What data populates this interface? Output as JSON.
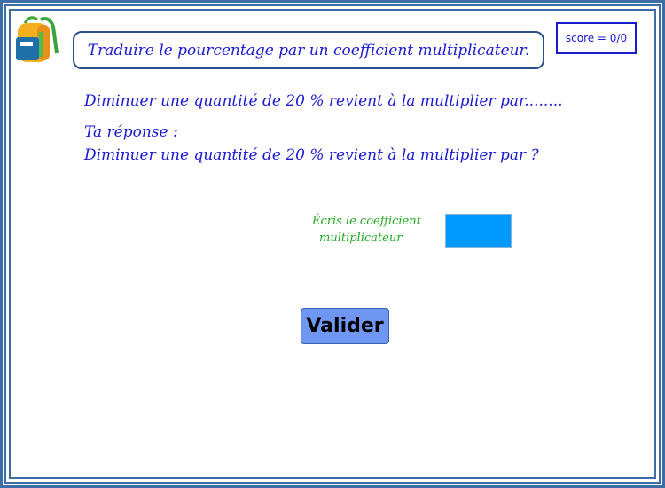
{
  "header": {
    "title": "Traduire le pourcentage par un coefficient multiplicateur.",
    "score": "score = 0/0"
  },
  "question": {
    "prompt": "Diminuer une quantité de 20 % revient à la multiplier par........",
    "answer_label": "Ta réponse :",
    "answer_restated": "Diminuer une quantité de 20 % revient à la multiplier par ?"
  },
  "input": {
    "instruction_line1": "Écris le coefficient",
    "instruction_line2": "multiplicateur",
    "value": "",
    "color": "#0099ff"
  },
  "actions": {
    "validate_label": "Valider"
  },
  "icons": {
    "logo": "backpack-icon"
  },
  "colors": {
    "text": "#1a1ad0",
    "instruction": "#22aa22",
    "button": "#6f96f0",
    "frame": "#3a6ea5"
  }
}
